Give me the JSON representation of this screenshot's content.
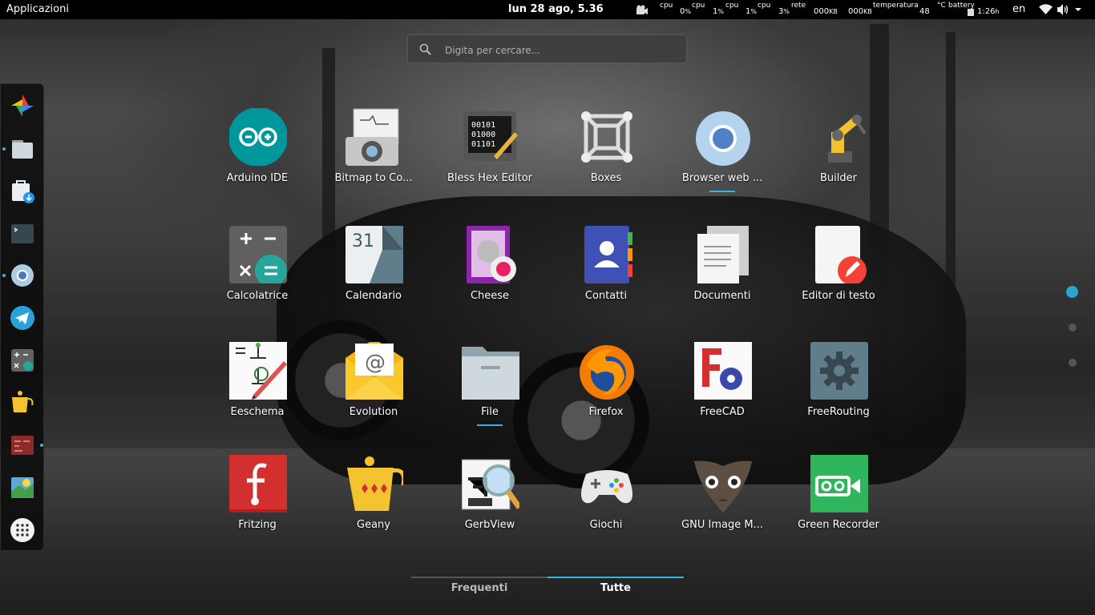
{
  "topbar": {
    "apps_label": "Applicazioni",
    "clock": "lun 28 ago,  5.36",
    "cpu1_label": "cpu",
    "cpu1_value": "0",
    "cpu2_label": "cpu",
    "cpu2_value": "1",
    "cpu3_label": "cpu",
    "cpu3_value": "1",
    "cpu4_label": "cpu",
    "cpu4_value": "3",
    "percent": "%",
    "net_label": "rete",
    "net_in": "000",
    "net_out": "000",
    "kb": "KB",
    "temp_label": "temperatura",
    "temp_value": "48",
    "temp_unit": "°C",
    "battery_label": "battery",
    "battery_value": "1:26",
    "battery_unit": "h",
    "lang": "en"
  },
  "search": {
    "placeholder": "Digita per cercare..."
  },
  "apps": [
    {
      "label": "Arduino IDE"
    },
    {
      "label": "Bitmap to Co..."
    },
    {
      "label": "Bless Hex Editor"
    },
    {
      "label": "Boxes"
    },
    {
      "label": "Browser web ..."
    },
    {
      "label": "Builder"
    },
    {
      "label": "Calcolatrice"
    },
    {
      "label": "Calendario"
    },
    {
      "label": "Cheese"
    },
    {
      "label": "Contatti"
    },
    {
      "label": "Documenti"
    },
    {
      "label": "Editor di testo"
    },
    {
      "label": "Eeschema"
    },
    {
      "label": "Evolution"
    },
    {
      "label": "File"
    },
    {
      "label": "Firefox"
    },
    {
      "label": "FreeCAD"
    },
    {
      "label": "FreeRouting"
    },
    {
      "label": "Fritzing"
    },
    {
      "label": "Geany"
    },
    {
      "label": "GerbView"
    },
    {
      "label": "Giochi"
    },
    {
      "label": "GNU Image M..."
    },
    {
      "label": "Green Recorder"
    }
  ],
  "calendar_day": "31",
  "hex_text": "00101\n01000\n01101",
  "tabs": {
    "frequent": "Frequenti",
    "all": "Tutte"
  },
  "colors": {
    "accent": "#3ab4d9"
  }
}
